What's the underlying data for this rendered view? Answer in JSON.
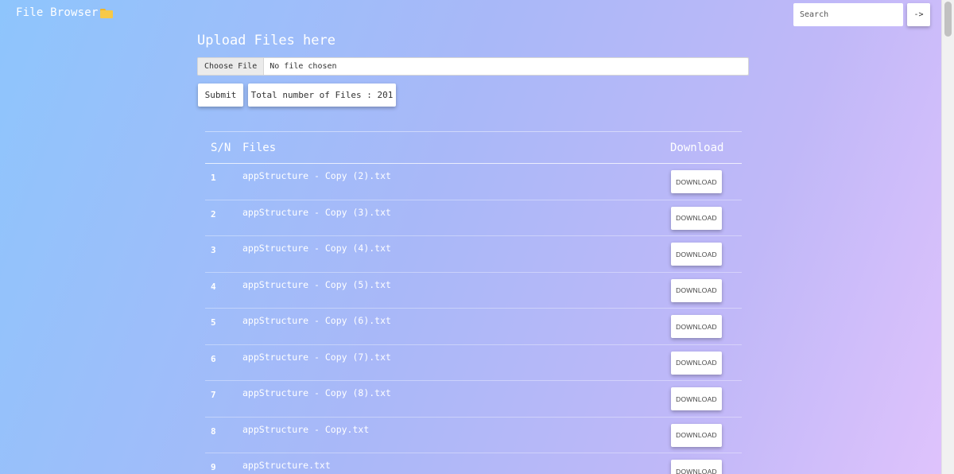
{
  "header": {
    "app_title": "File Browser",
    "search_placeholder": "Search",
    "search_button_label": "->"
  },
  "upload": {
    "heading": "Upload Files here",
    "choose_file_label": "Choose File",
    "no_file_text": "No file chosen",
    "submit_label": "Submit",
    "total_files_text": "Total number of Files : 201"
  },
  "table": {
    "headers": {
      "sn": "S/N",
      "files": "Files",
      "download": "Download"
    },
    "download_label": "DOWNLOAD",
    "rows": [
      {
        "sn": "1",
        "file": "appStructure - Copy (2).txt"
      },
      {
        "sn": "2",
        "file": "appStructure - Copy (3).txt"
      },
      {
        "sn": "3",
        "file": "appStructure - Copy (4).txt"
      },
      {
        "sn": "4",
        "file": "appStructure - Copy (5).txt"
      },
      {
        "sn": "5",
        "file": "appStructure - Copy (6).txt"
      },
      {
        "sn": "6",
        "file": "appStructure - Copy (7).txt"
      },
      {
        "sn": "7",
        "file": "appStructure - Copy (8).txt"
      },
      {
        "sn": "8",
        "file": "appStructure - Copy.txt"
      },
      {
        "sn": "9",
        "file": "appStructure.txt"
      }
    ]
  },
  "icons": {
    "title_icon": "folder-icon"
  },
  "colors": {
    "gradient_start": "#8ec5fc",
    "gradient_end": "#e0c3fc"
  }
}
